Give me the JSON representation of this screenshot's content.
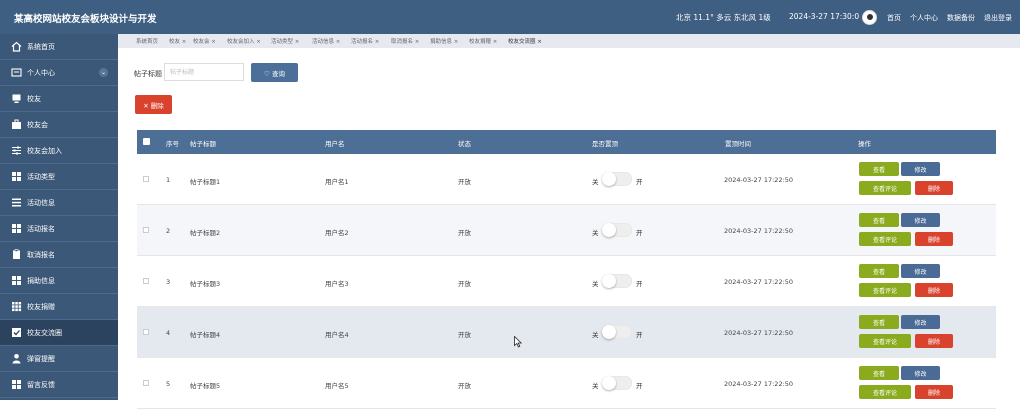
{
  "header": {
    "title": "某高校网站校友会板块设计与开发",
    "weather": "北京 11.1° 多云 东北风 1级",
    "datetime": "2024-3-27 17:30:0",
    "links": [
      "首页",
      "个人中心",
      "数据备份",
      "退出登录"
    ]
  },
  "sidebar": {
    "items": [
      {
        "label": "系统首页",
        "icon": "home-icon"
      },
      {
        "label": "个人中心",
        "icon": "user-card-icon"
      },
      {
        "label": "校友",
        "icon": "monitor-icon"
      },
      {
        "label": "校友会",
        "icon": "briefcase-icon"
      },
      {
        "label": "校友会加入",
        "icon": "sliders-icon"
      },
      {
        "label": "活动类型",
        "icon": "grid-icon"
      },
      {
        "label": "活动信息",
        "icon": "list-icon"
      },
      {
        "label": "活动报名",
        "icon": "grid-icon"
      },
      {
        "label": "取消报名",
        "icon": "clipboard-icon"
      },
      {
        "label": "捐助信息",
        "icon": "grid-icon"
      },
      {
        "label": "校友捐赠",
        "icon": "table-icon"
      },
      {
        "label": "校友交流圈",
        "icon": "check-icon"
      },
      {
        "label": "弹窗提醒",
        "icon": "person-icon"
      },
      {
        "label": "留言反馈",
        "icon": "grid-icon"
      }
    ]
  },
  "tabs": [
    "系统首页",
    "校友 ×",
    "校友会 ×",
    "校友会加入 ×",
    "活动类型 ×",
    "活动信息 ×",
    "活动报名 ×",
    "取消报名 ×",
    "捐助信息 ×",
    "校友捐赠 ×",
    "校友交流圈 ×"
  ],
  "search": {
    "label": "帖子标题",
    "placeholder": "帖子标题",
    "button": "♡ 查询"
  },
  "delete_button": "✕ 删除",
  "table": {
    "columns": [
      "序号",
      "帖子标题",
      "用户名",
      "状态",
      "是否置顶",
      "置顶时间",
      "操作"
    ],
    "rows": [
      {
        "no": "1",
        "title": "帖子标题1",
        "user": "用户名1",
        "status": "开放",
        "time": "2024-03-27 17:22:50"
      },
      {
        "no": "2",
        "title": "帖子标题2",
        "user": "用户名2",
        "status": "开放",
        "time": "2024-03-27 17:22:50"
      },
      {
        "no": "3",
        "title": "帖子标题3",
        "user": "用户名3",
        "status": "开放",
        "time": "2024-03-27 17:22:50"
      },
      {
        "no": "4",
        "title": "帖子标题4",
        "user": "用户名4",
        "status": "开放",
        "time": "2024-03-27 17:22:50"
      },
      {
        "no": "5",
        "title": "帖子标题5",
        "user": "用户名5",
        "status": "开放",
        "time": "2024-03-27 17:22:50"
      }
    ],
    "toggle_off": "关",
    "toggle_on": "开",
    "actions": {
      "view": "查看",
      "edit": "修改",
      "comment": "查看评论",
      "delete": "删除"
    }
  },
  "colors": {
    "header": "#3f5f82",
    "sidebar": "#3c5878",
    "table_head": "#4d6f96",
    "green": "#8bab1f",
    "red": "#d9432d",
    "blue": "#4a6b96"
  }
}
